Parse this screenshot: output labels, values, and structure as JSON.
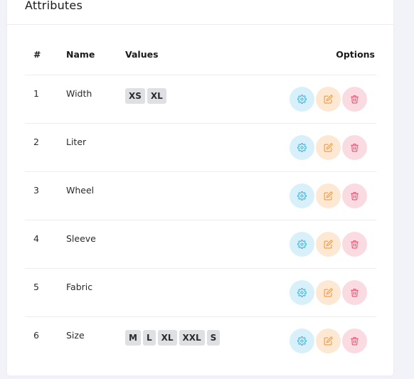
{
  "card": {
    "title": "Attributes"
  },
  "table": {
    "headers": {
      "num": "#",
      "name": "Name",
      "values": "Values",
      "options": "Options"
    },
    "rows": [
      {
        "num": "1",
        "name": "Width",
        "values": [
          "XS",
          "XL"
        ]
      },
      {
        "num": "2",
        "name": "Liter",
        "values": []
      },
      {
        "num": "3",
        "name": "Wheel",
        "values": []
      },
      {
        "num": "4",
        "name": "Sleeve",
        "values": []
      },
      {
        "num": "5",
        "name": "Fabric",
        "values": []
      },
      {
        "num": "6",
        "name": "Size",
        "values": [
          "M",
          "L",
          "XL",
          "XXL",
          "S"
        ]
      }
    ]
  },
  "icons": {
    "settings": "gear-icon",
    "edit": "edit-icon",
    "delete": "trash-icon"
  },
  "colors": {
    "settings_bg": "#d8f0fa",
    "settings_fg": "#3fb6e3",
    "edit_bg": "#fde8d4",
    "edit_fg": "#f2993e",
    "delete_bg": "#fbdbe2",
    "delete_fg": "#ee4d6d",
    "badge_bg": "#dee0e4"
  }
}
